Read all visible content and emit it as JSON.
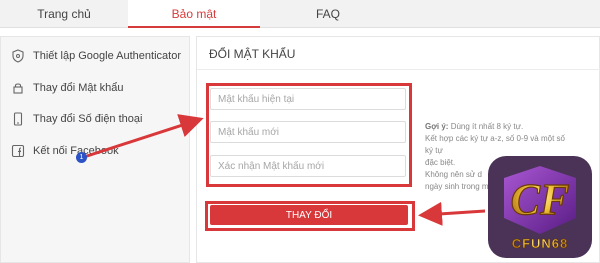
{
  "tabs": [
    {
      "label": "Trang chủ"
    },
    {
      "label": "Bảo mật"
    },
    {
      "label": "FAQ"
    }
  ],
  "sidebar": {
    "items": [
      {
        "label": "Thiết lập Google Authenticator",
        "icon": "shield-icon"
      },
      {
        "label": "Thay đổi Mật khẩu",
        "icon": "lock-icon"
      },
      {
        "label": "Thay đổi Số điện thoại",
        "icon": "phone-icon"
      },
      {
        "label": "Kết nối Facebook",
        "icon": "facebook-icon"
      }
    ]
  },
  "panel": {
    "title": "ĐỔI MẬT KHẨU",
    "fields": [
      {
        "placeholder": "Mật khẩu hiện tại"
      },
      {
        "placeholder": "Mật khẩu mới"
      },
      {
        "placeholder": "Xác nhận Mật khẩu mới"
      }
    ],
    "submit_label": "THAY ĐỔI",
    "hint": {
      "label": "Gợi ý:",
      "line1": "Dùng ít nhất 8 ký tự.",
      "line2": "Kết hợp các ký tự a-z, số 0-9 và một số ký tự",
      "line3": "đặc biệt.",
      "line4": "Không nên sử d",
      "line5": "ngày sinh trong m"
    }
  },
  "annotation": {
    "badge": "1"
  },
  "logo": {
    "text": "CFUN68",
    "mark": "CF"
  },
  "colors": {
    "accent": "#d9383a",
    "badge": "#2c52c6",
    "logo_gold": "#f2c23a",
    "logo_purple": "#7a2aa8"
  }
}
